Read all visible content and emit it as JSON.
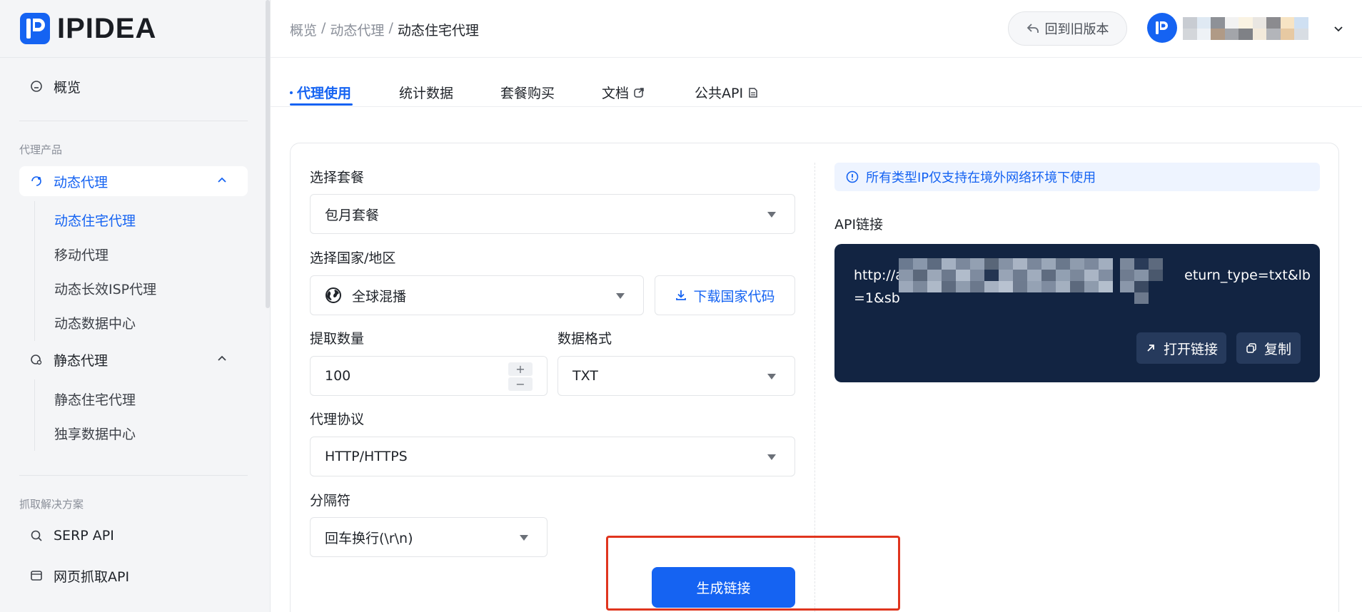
{
  "app": {
    "logo_text": "IPIDEA"
  },
  "sidebar": {
    "overview": "概览",
    "section_proxy": "代理产品",
    "dynamic_proxy": "动态代理",
    "dynamic_sub": [
      "动态住宅代理",
      "移动代理",
      "动态长效ISP代理",
      "动态数据中心"
    ],
    "static_proxy": "静态代理",
    "static_sub": [
      "静态住宅代理",
      "独享数据中心"
    ],
    "section_scrape": "抓取解决方案",
    "serp_api": "SERP API",
    "web_scrape_api": "网页抓取API"
  },
  "header": {
    "breadcrumb": [
      "概览",
      "动态代理",
      "动态住宅代理"
    ],
    "separator": "/",
    "old_version": "回到旧版本"
  },
  "tabs": [
    "代理使用",
    "统计数据",
    "套餐购买",
    "文档",
    "公共API"
  ],
  "form": {
    "package_label": "选择套餐",
    "package_value": "包月套餐",
    "country_label": "选择国家/地区",
    "country_value": "全球混播",
    "download_codes": "下载国家代码",
    "quantity_label": "提取数量",
    "quantity_value": "100",
    "format_label": "数据格式",
    "format_value": "TXT",
    "protocol_label": "代理协议",
    "protocol_value": "HTTP/HTTPS",
    "separator_label": "分隔符",
    "separator_value": "回车换行(\\r\\n)",
    "generate_button": "生成链接"
  },
  "api_panel": {
    "notice": "所有类型IP仅支持在境外网络环境下使用",
    "label": "API链接",
    "line1_start": "http://a",
    "line1_end": "eturn_type=txt&lb",
    "line2_start": "=1&sb",
    "open_link": "打开链接",
    "copy": "复制"
  },
  "colors": {
    "accent": "#1563f2",
    "api_bg": "#122442",
    "highlight": "#e0351e"
  }
}
